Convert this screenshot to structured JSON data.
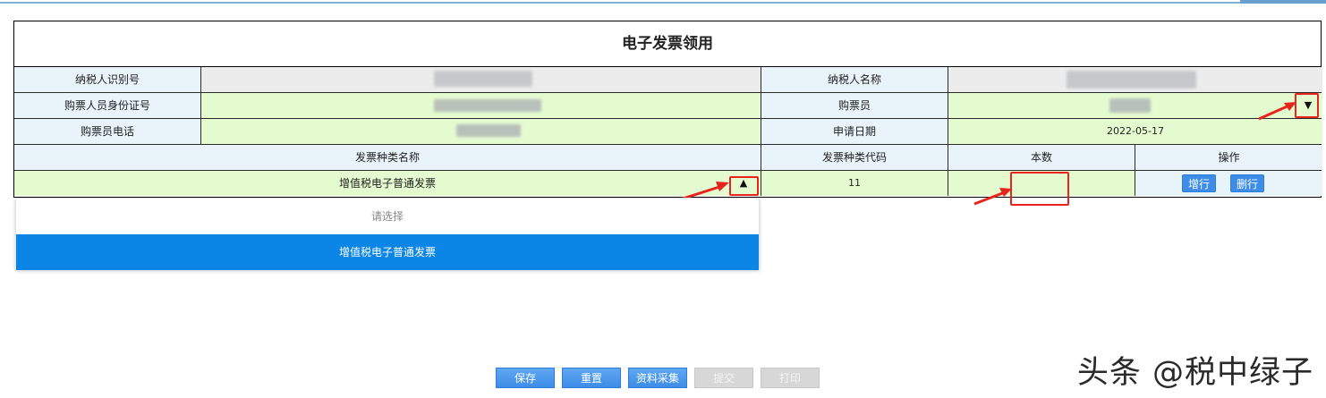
{
  "form": {
    "title": "电子发票领用",
    "fields": {
      "taxpayer_id_label": "纳税人识别号",
      "taxpayer_name_label": "纳税人名称",
      "buyer_id_label": "购票人员身份证号",
      "buyer_label": "购票员",
      "buyer_phone_label": "购票员电话",
      "apply_date_label": "申请日期",
      "apply_date_value": "2022-05-17"
    },
    "table": {
      "headers": {
        "type_name": "发票种类名称",
        "type_code": "发票种类代码",
        "count": "本数",
        "operation": "操作"
      },
      "row": {
        "type_name": "增值税电子普通发票",
        "type_code": "11",
        "count": ""
      },
      "add_row_label": "增行",
      "delete_row_label": "删行"
    }
  },
  "dropdown": {
    "placeholder": "请选择",
    "options": [
      "增值税电子普通发票"
    ],
    "selected_index": 0
  },
  "buttons": {
    "save": "保存",
    "reset": "重置",
    "collect": "资料采集",
    "submit": "提交",
    "print": "打印"
  },
  "watermark": "头条 @税中绿子",
  "colors": {
    "label_bg": "#e8f3fa",
    "editable_bg": "#e4fbcf",
    "readonly_bg": "#ececec",
    "primary_button": "#3d8de8",
    "selected_option": "#0b85e6",
    "annotation_red": "#e8241c"
  }
}
